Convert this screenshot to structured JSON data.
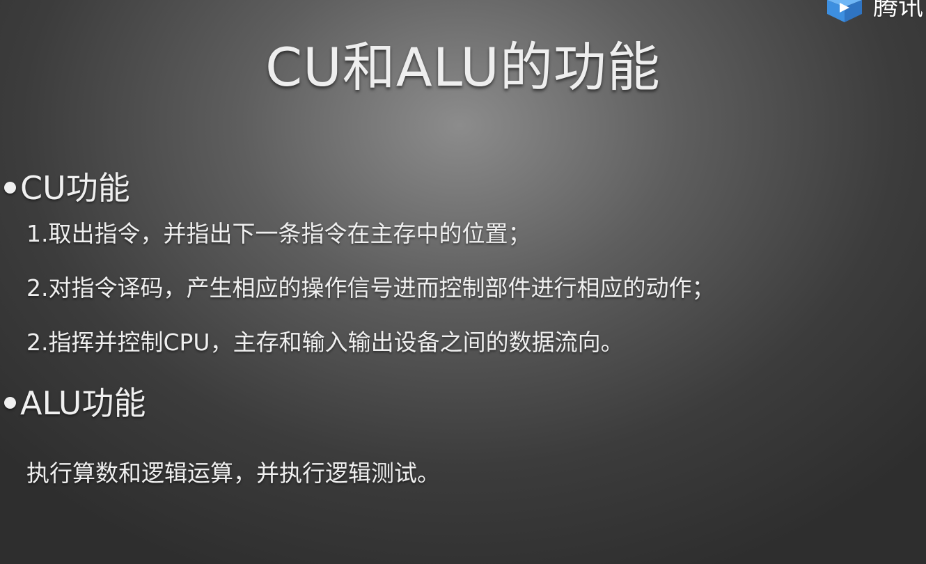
{
  "slide": {
    "title": "CU和ALU的功能",
    "sections": [
      {
        "heading": "CU功能",
        "items": [
          "1.取出指令，并指出下一条指令在主存中的位置；",
          "2.对指令译码，产生相应的操作信号进而控制部件进行相应的动作；",
          "2.指挥并控制CPU，主存和输入输出设备之间的数据流向。"
        ]
      },
      {
        "heading": "ALU功能",
        "items": [
          "执行算数和逻辑运算，并执行逻辑测试。"
        ]
      }
    ]
  },
  "watermark": {
    "icon": "tencent-classroom-logo-icon",
    "text": "腾讯",
    "colors": {
      "primary": "#3d8fe0",
      "secondary": "#6fb6f5"
    }
  }
}
